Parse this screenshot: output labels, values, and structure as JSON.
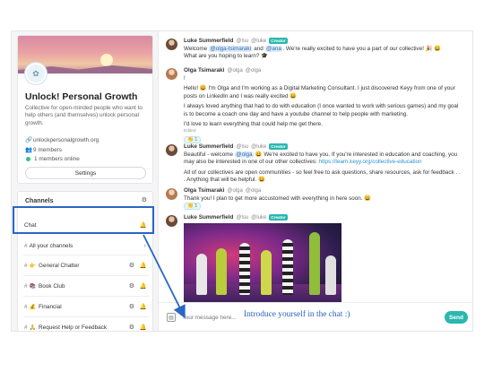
{
  "community": {
    "title": "Unlock! Personal Growth",
    "description": "Collective for open-minded people who want to help others (and themselves) unlock personal growth.",
    "url": "unlockpersonalgrowth.org",
    "members": "9 members",
    "online": "1 members online",
    "settings_label": "Settings"
  },
  "channels": {
    "header": "Channels",
    "items": [
      {
        "label": "Chat",
        "emoji": "",
        "prefix": ""
      },
      {
        "label": "All your channels",
        "emoji": "",
        "prefix": "#"
      },
      {
        "label": "General Chatter",
        "emoji": "👉",
        "prefix": "#"
      },
      {
        "label": "Book Club",
        "emoji": "📚",
        "prefix": "#"
      },
      {
        "label": "Financial",
        "emoji": "💰",
        "prefix": "#"
      },
      {
        "label": "Request Help or Feedback",
        "emoji": "🙏",
        "prefix": "#"
      }
    ]
  },
  "messages": {
    "m1": {
      "author": "Luke Summerfield",
      "handle": "@lsu",
      "role": "@luke",
      "badge": "Creator",
      "line1_a": "Welcome",
      "mention1": "@olga-tsimaraki",
      "line1_b": "and",
      "mention2": "@ana",
      "line1_c": ". We're really excited to have you a part of our collective! 🎉 😀",
      "line2": "What are you hoping to learn? 🎓"
    },
    "m2": {
      "author": "Olga Tsimaraki",
      "handle": "@olga",
      "role": "@olga",
      "p0": "!",
      "p1": "Hello! 😀 I'm Olga and I'm working as a Digital Marketing Consultant. I just discovered Keyy from one of your posts on LinkedIn and I was really excited 😀",
      "p2": "I always loved anything that had to do with education (I once wanted to work with serious games) and my goal is to become a coach one day and have a youtube channel to help people with marketing.",
      "p3": "I'd love to learn everything that could help me get there.",
      "edited": "Edited",
      "reaction": "👏 1"
    },
    "m3": {
      "author": "Luke Summerfield",
      "handle": "@lsu",
      "role": "@luke",
      "badge": "Creator",
      "p1_a": "Beautiful - welcome",
      "mention": "@olga",
      "p1_b": "😀 We're excited to have you. If you're interested in education and coaching, you may also be interested in one of our other collectives:",
      "link": "https://learn.keyy.org/collective-education",
      "p2": "All of our collectives are open communities - so feel free to ask questions, share resources, ask for feedback . . . Anything that will be helpful. 😀"
    },
    "m4": {
      "author": "Olga Tsimaraki",
      "handle": "@olga",
      "role": "@olga",
      "p1": "Thank you! I plan to get more accustomed with everything in here soon. 😀",
      "reaction": "👏 1"
    },
    "m5": {
      "author": "Luke Summerfield",
      "handle": "@lsu",
      "role": "@luke",
      "badge": "Creator"
    }
  },
  "composer": {
    "placeholder": "Your message here...",
    "send_label": "Send"
  },
  "annotation": {
    "text": "Introduce yourself in the chat :)",
    "color": "#2a66c4"
  },
  "colors": {
    "accent": "#2bb7b0",
    "mention_bg": "#dfeaf7",
    "link": "#2d8fd5"
  }
}
